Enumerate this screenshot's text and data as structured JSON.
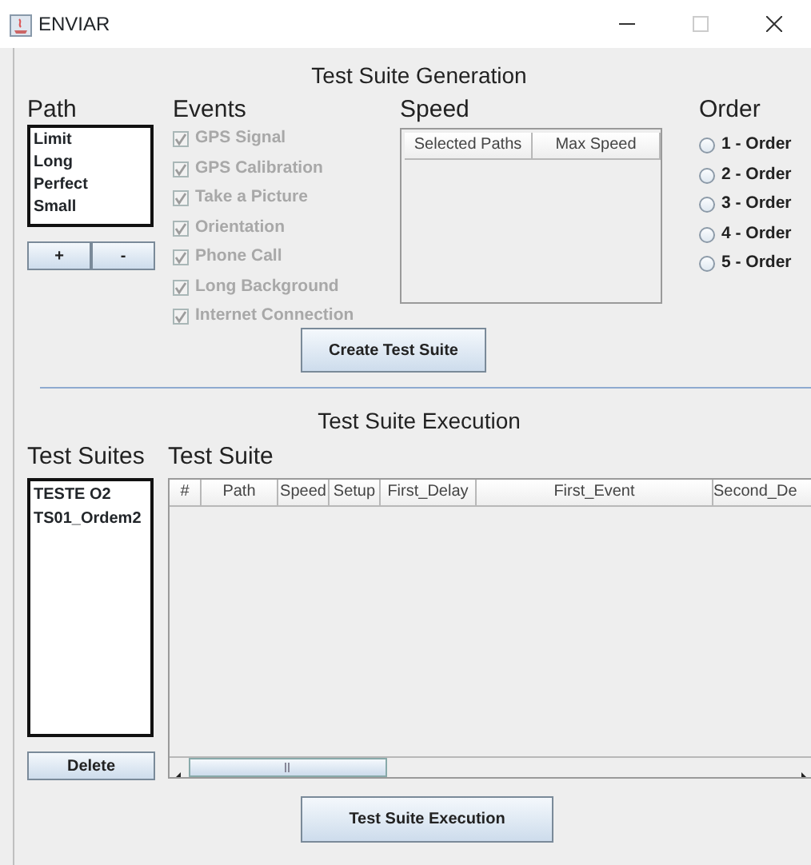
{
  "window": {
    "title": "ENVIAR",
    "maximize_disabled": true
  },
  "generation": {
    "title": "Test Suite Generation",
    "path": {
      "heading": "Path",
      "items": [
        "Limit",
        "Long",
        "Perfect",
        "Small"
      ],
      "buttons": [
        "+",
        "-"
      ]
    },
    "events": {
      "heading": "Events",
      "items": [
        {
          "label": "GPS Signal",
          "checked": true,
          "disabled": true
        },
        {
          "label": "GPS Calibration",
          "checked": true,
          "disabled": true
        },
        {
          "label": "Take a Picture",
          "checked": true,
          "disabled": true
        },
        {
          "label": "Orientation",
          "checked": true,
          "disabled": true
        },
        {
          "label": "Phone Call",
          "checked": true,
          "disabled": true
        },
        {
          "label": "Long Background",
          "checked": true,
          "disabled": true
        },
        {
          "label": "Internet Connection",
          "checked": true,
          "disabled": true
        }
      ]
    },
    "speed": {
      "heading": "Speed",
      "columns": [
        "Selected Paths",
        "Max Speed"
      ]
    },
    "order": {
      "heading": "Order",
      "options": [
        {
          "label": "1 - Order",
          "selected": false
        },
        {
          "label": "2 - Order",
          "selected": false
        },
        {
          "label": "3 - Order",
          "selected": false
        },
        {
          "label": "4 - Order",
          "selected": false
        },
        {
          "label": "5 - Order",
          "selected": false
        }
      ]
    },
    "button": "Create Test Suite"
  },
  "execution": {
    "title": "Test Suite Execution",
    "suites": {
      "heading": "Test Suites",
      "items": [
        "TESTE O2",
        "TS01_Ordem2"
      ],
      "button": "Delete"
    },
    "table": {
      "heading": "Test Suite",
      "columns": [
        "#",
        "Path",
        "Speed",
        "Setup",
        "First_Delay",
        "First_Event",
        "Second_De"
      ]
    },
    "button": "Test Suite Execution"
  }
}
